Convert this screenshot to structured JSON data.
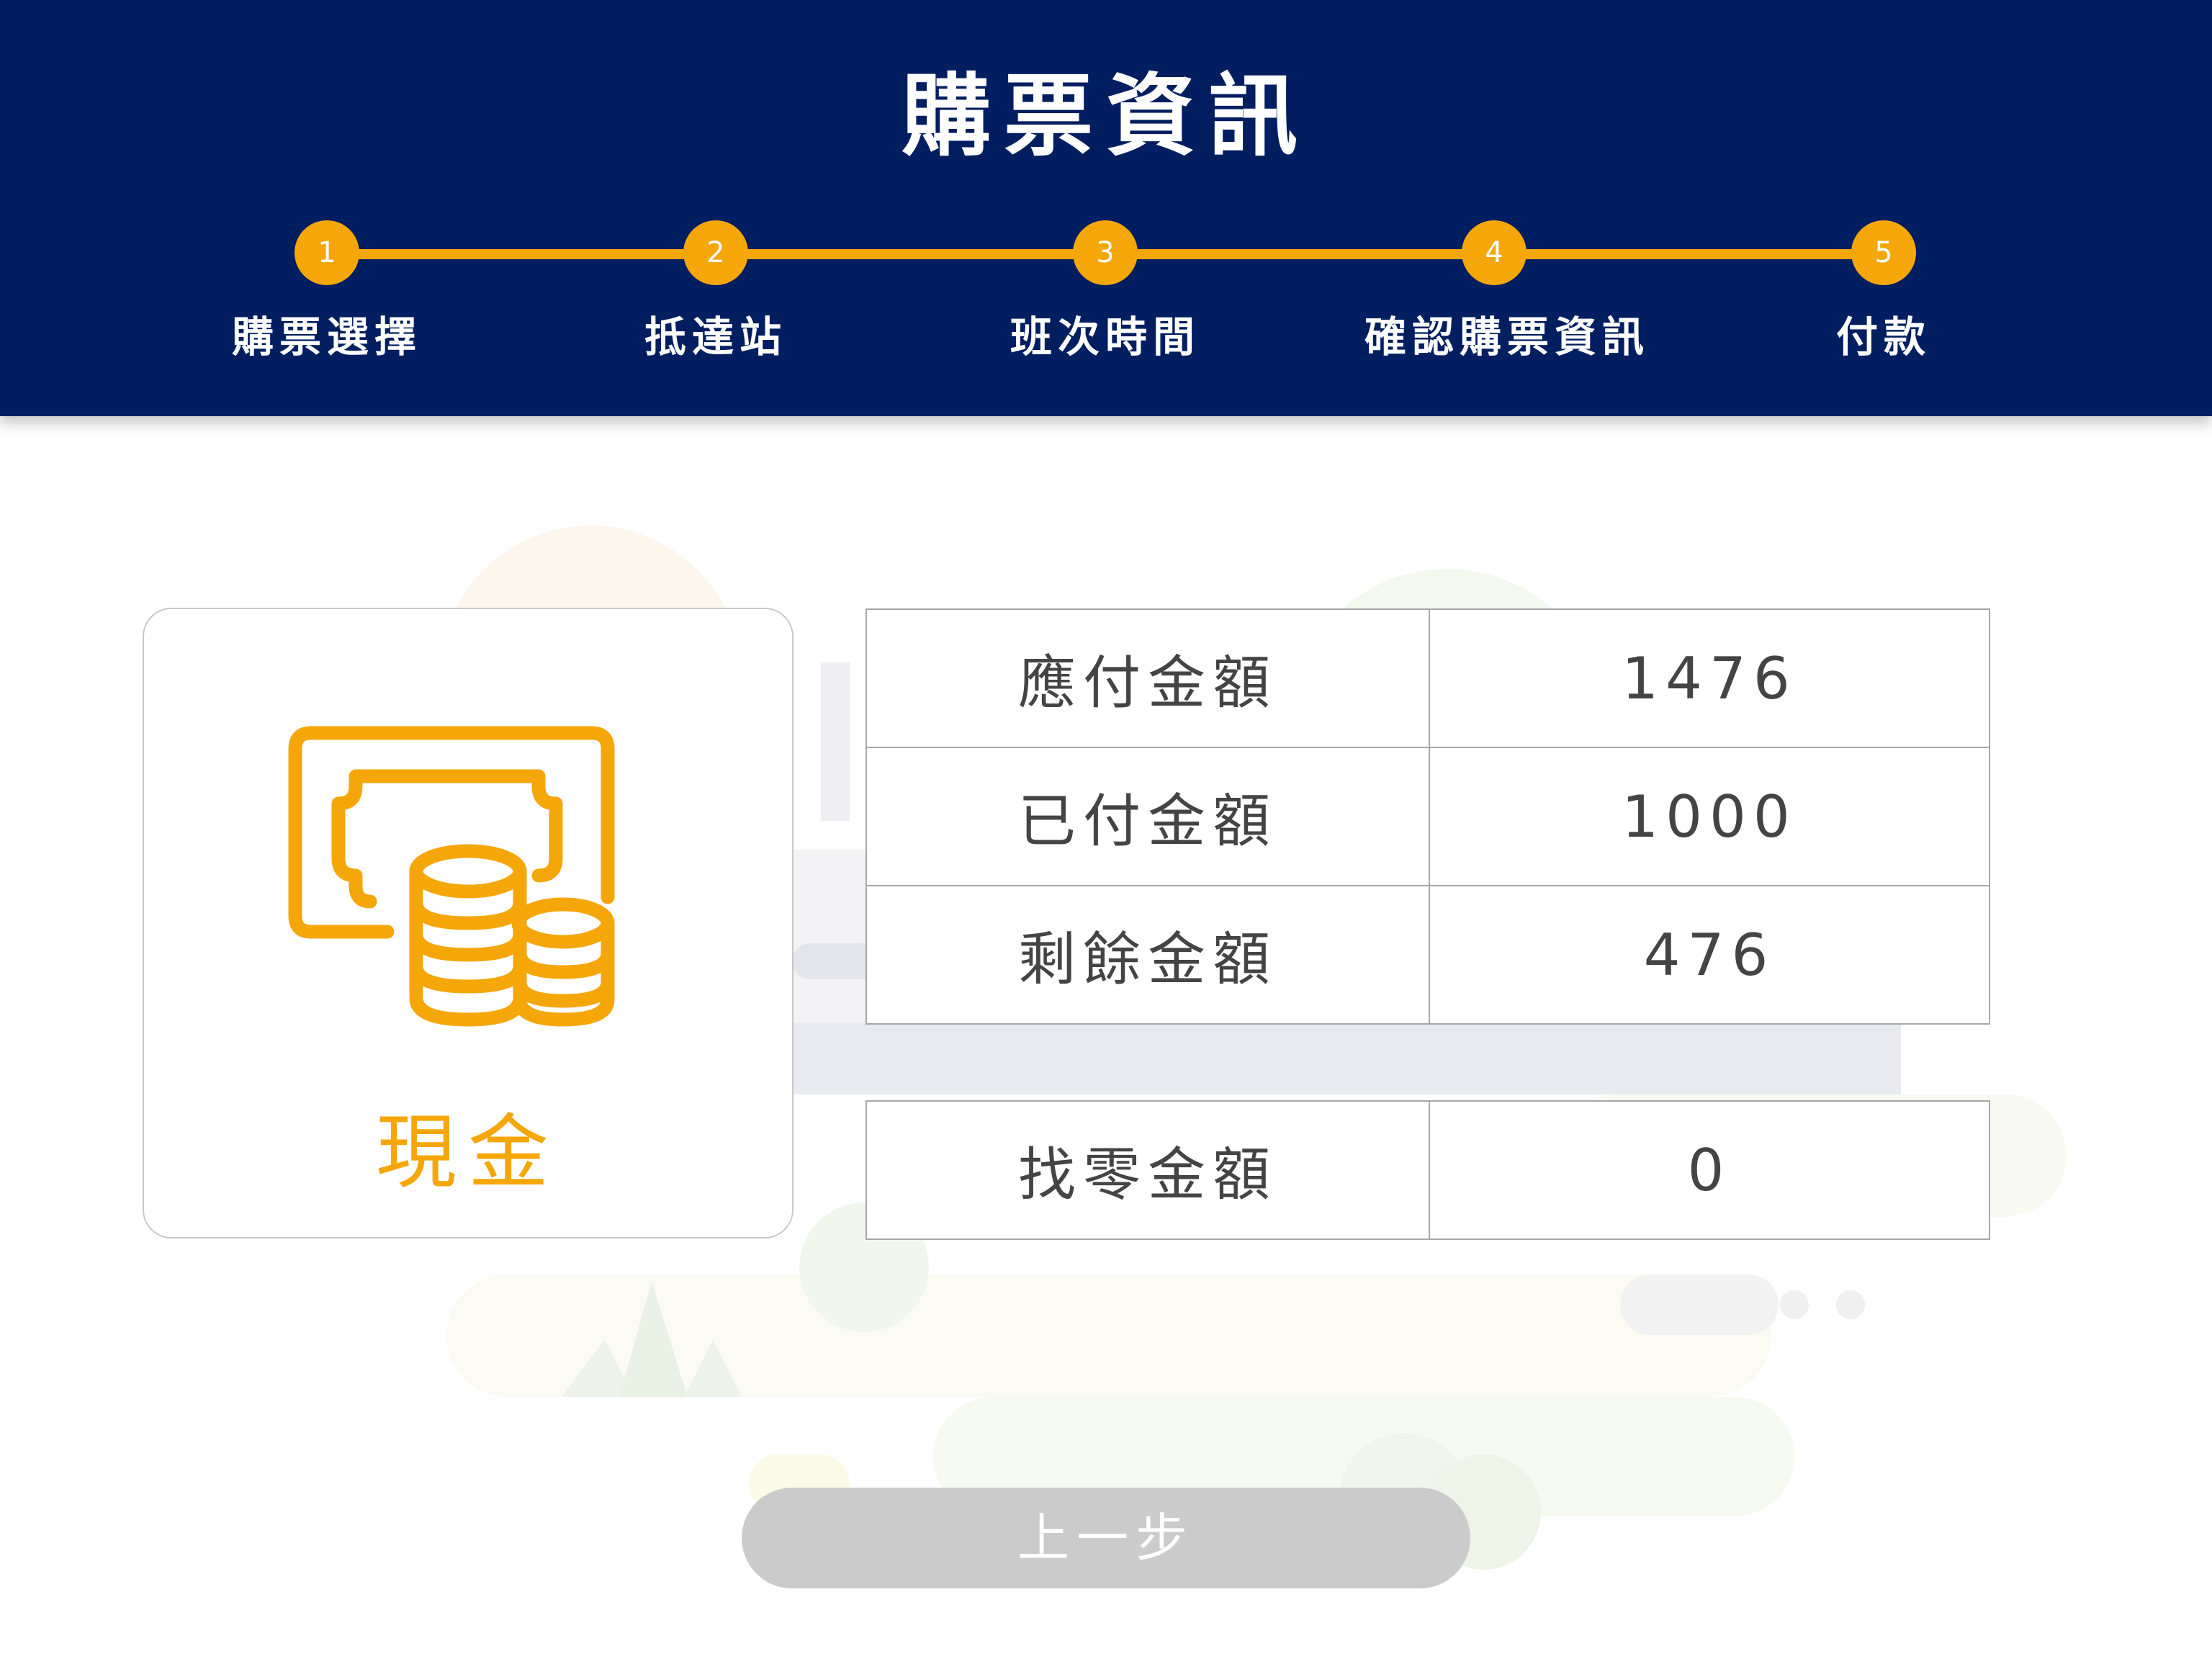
{
  "header": {
    "title": "購票資訊",
    "steps": [
      {
        "number": "1",
        "label": "購票選擇"
      },
      {
        "number": "2",
        "label": "抵達站"
      },
      {
        "number": "3",
        "label": "班次時間"
      },
      {
        "number": "4",
        "label": "確認購票資訊"
      },
      {
        "number": "5",
        "label": "付款"
      }
    ]
  },
  "payment_method": {
    "icon": "cash-money-icon",
    "label": "現金"
  },
  "amounts": [
    {
      "label": "應付金額",
      "value": "1476"
    },
    {
      "label": "已付金額",
      "value": "1000"
    },
    {
      "label": "剩餘金額",
      "value": "476"
    }
  ],
  "change": {
    "label": "找零金額",
    "value": "0"
  },
  "back_button_label": "上一步",
  "colors": {
    "header_bg": "#001e60",
    "accent": "#f5a70a",
    "button_bg": "#cbcbcb"
  }
}
